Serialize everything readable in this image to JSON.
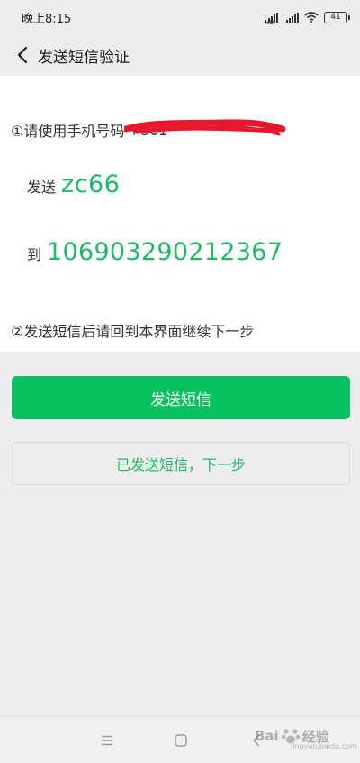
{
  "status_bar": {
    "time": "晚上8:15",
    "battery": "41"
  },
  "header": {
    "title": "发送短信验证"
  },
  "instructions": {
    "step1_prefix": "①请使用手机号码",
    "phone_visible": "+861",
    "send_label": "发送",
    "send_code": "zc66",
    "to_label": "到",
    "to_number": "106903290212367",
    "step2": "②发送短信后请回到本界面继续下一步"
  },
  "buttons": {
    "send_sms": "发送短信",
    "sent_next": "已发送短信，下一步"
  },
  "watermark": {
    "text": "Bai",
    "text2": "经验",
    "url": "jingyan.baidu.com"
  },
  "colors": {
    "accent": "#07c160",
    "accent_text": "#21b868",
    "redaction": "#e8172b"
  },
  "icons": {
    "back": "chevron-left-icon",
    "signal": "signal-icon",
    "wifi": "wifi-icon",
    "battery": "battery-icon",
    "menu": "menu-icon",
    "home": "home-icon",
    "sys_back": "back-icon"
  }
}
